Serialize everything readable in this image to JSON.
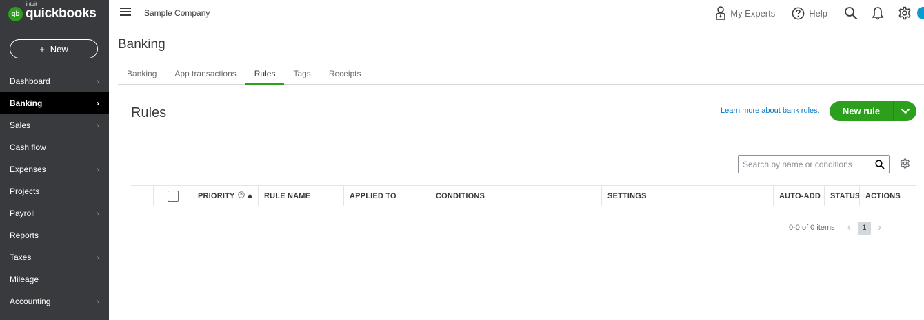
{
  "brand": {
    "logo_mark": "qb",
    "intuit": "intuit",
    "name": "quickbooks"
  },
  "sidebar": {
    "new_button": {
      "icon": "+",
      "label": "New"
    },
    "items": [
      {
        "label": "Dashboard",
        "chevron": true,
        "active": false
      },
      {
        "label": "Banking",
        "chevron": true,
        "active": true
      },
      {
        "label": "Sales",
        "chevron": true,
        "active": false
      },
      {
        "label": "Cash flow",
        "chevron": false,
        "active": false
      },
      {
        "label": "Expenses",
        "chevron": true,
        "active": false
      },
      {
        "label": "Projects",
        "chevron": false,
        "active": false
      },
      {
        "label": "Payroll",
        "chevron": true,
        "active": false
      },
      {
        "label": "Reports",
        "chevron": false,
        "active": false
      },
      {
        "label": "Taxes",
        "chevron": true,
        "active": false
      },
      {
        "label": "Mileage",
        "chevron": false,
        "active": false
      },
      {
        "label": "Accounting",
        "chevron": true,
        "active": false
      }
    ]
  },
  "header": {
    "company": "Sample Company",
    "my_experts": "My Experts",
    "help": "Help"
  },
  "page": {
    "title": "Banking",
    "tabs": [
      {
        "label": "Banking",
        "active": false
      },
      {
        "label": "App transactions",
        "active": false
      },
      {
        "label": "Rules",
        "active": true
      },
      {
        "label": "Tags",
        "active": false
      },
      {
        "label": "Receipts",
        "active": false
      }
    ]
  },
  "rules": {
    "title": "Rules",
    "learn_link": "Learn more about bank rules.",
    "new_rule_button": "New rule",
    "search_placeholder": "Search by name or conditions",
    "columns": [
      {
        "label": "",
        "width": 32
      },
      {
        "label": "checkbox",
        "width": 56
      },
      {
        "label": "PRIORITY",
        "width": 96
      },
      {
        "label": "RULE NAME",
        "width": 124
      },
      {
        "label": "APPLIED TO",
        "width": 125
      },
      {
        "label": "CONDITIONS",
        "width": 249
      },
      {
        "label": "SETTINGS",
        "width": 249
      },
      {
        "label": "AUTO-ADD",
        "width": 74
      },
      {
        "label": "STATUS",
        "width": 51
      },
      {
        "label": "ACTIONS",
        "width": 82
      }
    ],
    "pager": {
      "count_text": "0-0 of 0 items",
      "current_page": "1"
    }
  },
  "colors": {
    "brand_green": "#2ca01c",
    "sidebar_bg": "#393a3d",
    "link_blue": "#0077c5"
  }
}
